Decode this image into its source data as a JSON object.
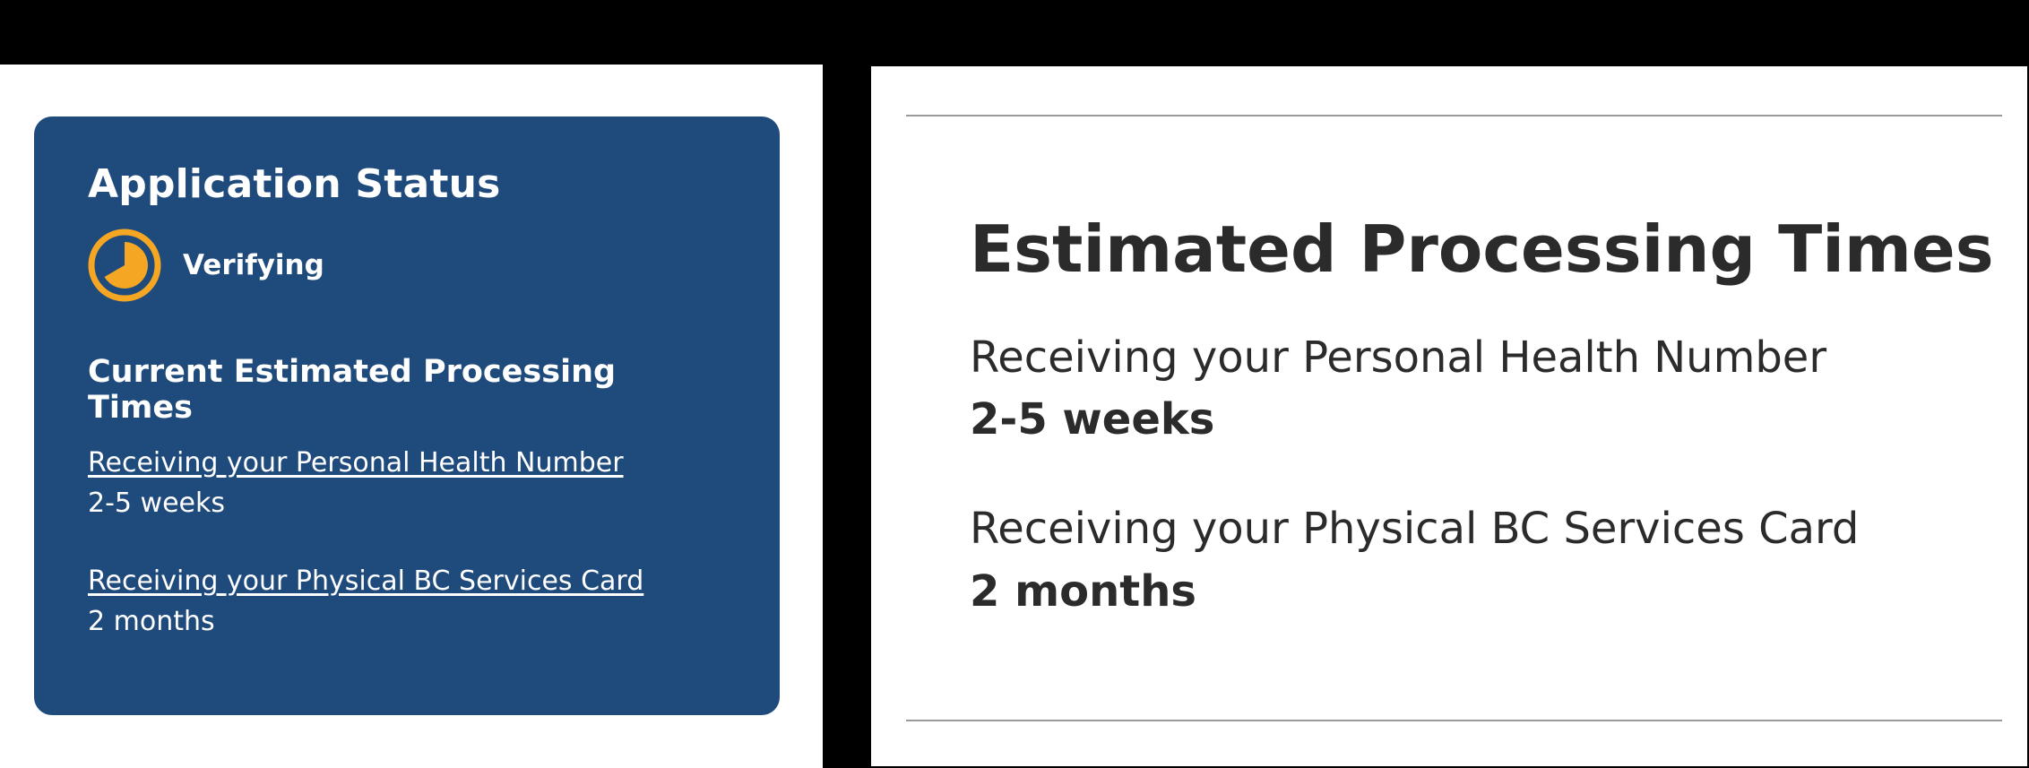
{
  "colors": {
    "card_bg": "#1f4a7c",
    "status_accent": "#f5a623"
  },
  "status_card": {
    "title": "Application Status",
    "status_icon": "clock-progress-icon",
    "status_text": "Verifying",
    "estimates_title": "Current Estimated Processing Times",
    "items": [
      {
        "label": "Receiving your Personal Health Number",
        "value": "2-5 weeks"
      },
      {
        "label": "Receiving your Physical BC Services Card",
        "value": "2 months"
      }
    ]
  },
  "estimates_panel": {
    "title": "Estimated Processing Times",
    "items": [
      {
        "label": "Receiving your Personal Health Number",
        "value": "2-5 weeks"
      },
      {
        "label": "Receiving your Physical BC Services Card",
        "value": "2 months"
      }
    ]
  }
}
